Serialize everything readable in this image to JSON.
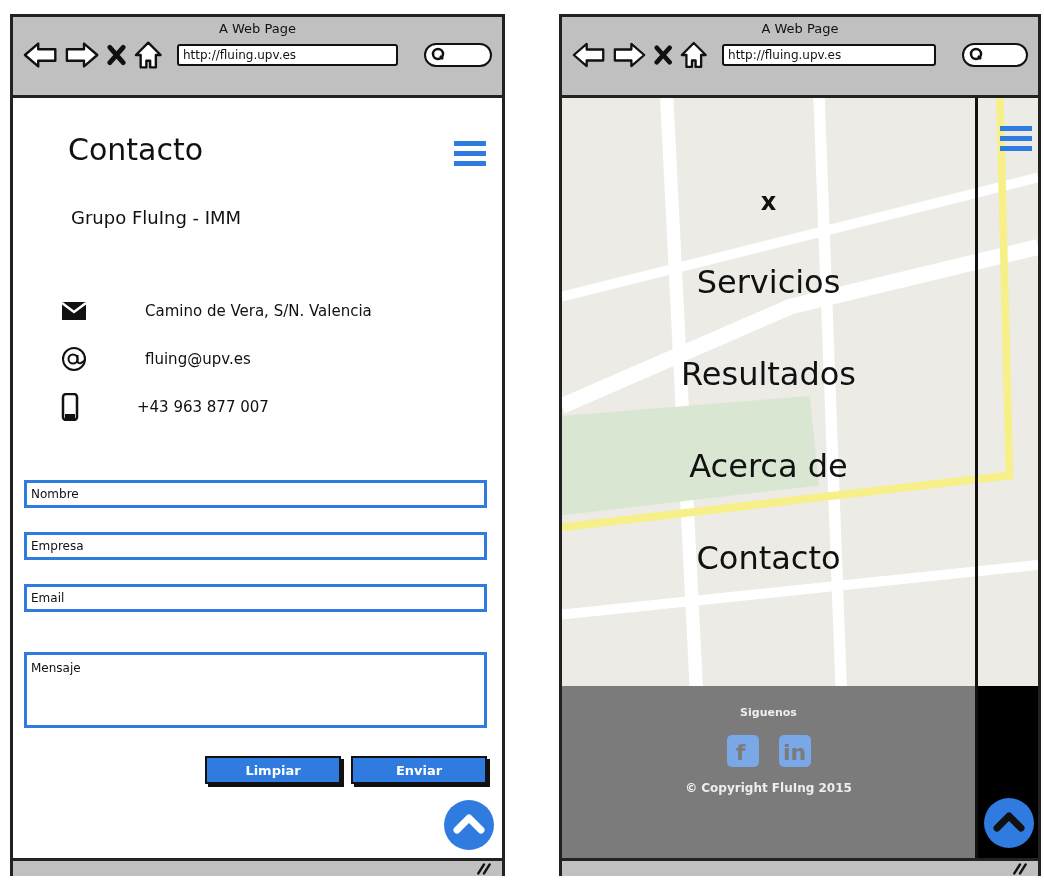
{
  "windows": [
    {
      "kind": "contact",
      "title": "A Web Page",
      "url": "http://fluing.upv.es",
      "heading": "Contacto",
      "subheading": "Grupo FluIng - IMM",
      "contacts": [
        {
          "kind": "address",
          "text": "Camino de Vera, S/N. Valencia"
        },
        {
          "kind": "email",
          "text": "fluing@upv.es"
        },
        {
          "kind": "phone",
          "text": "+43 963 877 007"
        }
      ],
      "fields": [
        {
          "kind": "line",
          "placeholder": "Nombre"
        },
        {
          "kind": "line",
          "placeholder": "Empresa"
        },
        {
          "kind": "line",
          "placeholder": "Email"
        },
        {
          "kind": "area",
          "placeholder": "Mensaje"
        }
      ],
      "buttons": [
        "Limpiar",
        "Enviar"
      ]
    },
    {
      "kind": "menu",
      "title": "A Web Page",
      "url": "http://fluing.upv.es",
      "close_label": "x",
      "menu_items": [
        "Servicios",
        "Resultados",
        "Acerca de",
        "Contacto"
      ],
      "footer": {
        "title": "Siguenos",
        "social": [
          {
            "kind": "facebook",
            "glyph": "f"
          },
          {
            "kind": "linkedin",
            "glyph": "in"
          }
        ],
        "copyright": "© Copyright FluIng 2015"
      }
    }
  ]
}
